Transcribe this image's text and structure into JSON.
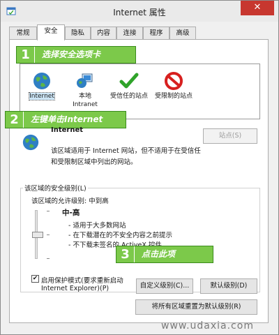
{
  "window": {
    "title": "Internet 属性",
    "close_glyph": "✕"
  },
  "tabs": [
    {
      "label": "常规"
    },
    {
      "label": "安全"
    },
    {
      "label": "隐私"
    },
    {
      "label": "内容"
    },
    {
      "label": "连接"
    },
    {
      "label": "程序"
    },
    {
      "label": "高级"
    }
  ],
  "active_tab": "安全",
  "zones": [
    {
      "label": "Internet",
      "icon": "globe-icon"
    },
    {
      "label": "本地\nIntranet",
      "icon": "intranet-icon"
    },
    {
      "label": "受信任的站点",
      "icon": "checkmark-icon"
    },
    {
      "label": "受限制的站点",
      "icon": "blocked-icon"
    }
  ],
  "callouts": [
    {
      "number": "1",
      "text": "选择安全选项卡"
    },
    {
      "number": "2",
      "text": "左键单击Internet"
    },
    {
      "number": "3",
      "text": "点击此项"
    }
  ],
  "zone_info": {
    "name": "Internet",
    "sites_button": "站点(S)",
    "description_line1": "该区域适用于 Internet 网站，但不适用于在受信任",
    "description_line2": "和受限制区域中列出的网站。"
  },
  "security": {
    "group_label": "该区域的安全级别(L)",
    "allowed_levels": "该区域的允许级别: 中到高",
    "level_name": "中-高",
    "bullets": [
      "- 适用于大多数网站",
      "- 在下载潜在的不安全内容之前提示",
      "- 不下载未签名的 ActiveX 控件"
    ]
  },
  "protected_mode": {
    "checked": true,
    "check_glyph": "✔",
    "label_line1": "启用保护模式(要求重新启动",
    "label_line2": "Internet Explorer)(P)"
  },
  "buttons": {
    "custom_level": "自定义级别(C)...",
    "default_level": "默认级别(D)",
    "reset_all": "将所有区域重置为默认级别(R)"
  },
  "watermark": "www.udaxia.com",
  "colors": {
    "callout_green": "#7cc94a",
    "close_red": "#c7372f"
  }
}
